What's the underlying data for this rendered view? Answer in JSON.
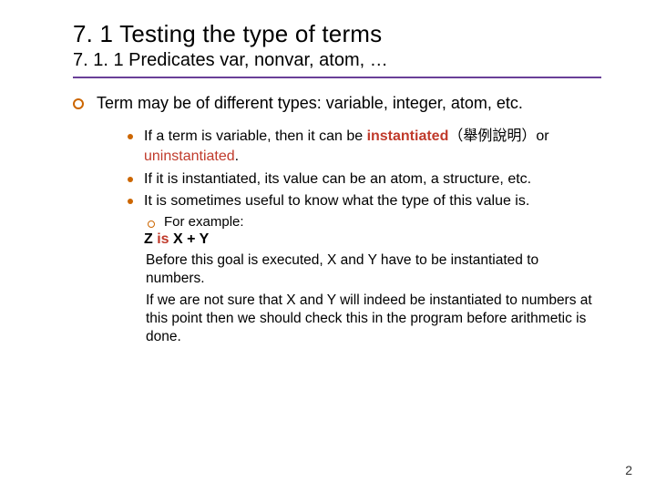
{
  "title": "7. 1 Testing the type of terms",
  "subtitle": "7. 1. 1 Predicates var, nonvar, atom, …",
  "level1": "Term may be of different types: variable, integer, atom, etc.",
  "b1_pre": "If a term is variable, then it can be ",
  "b1_hl1": "instantiated",
  "b1_mid": "（舉例說明）or ",
  "b1_hl2": "uninstantiated",
  "b1_end": ".",
  "b2": "If it is instantiated, its value can be an atom, a structure, etc.",
  "b3": "It is sometimes useful to know what the type of this value is.",
  "ex_label": "For example:",
  "code_z": "Z ",
  "code_is": "is",
  "code_xy": " X + Y",
  "para1": "Before this goal is executed, X and Y have to be instantiated to numbers.",
  "para2": "If we are not sure that X and Y will indeed be instantiated to numbers at this point then we should check this in the program before arithmetic is done.",
  "page": "2"
}
